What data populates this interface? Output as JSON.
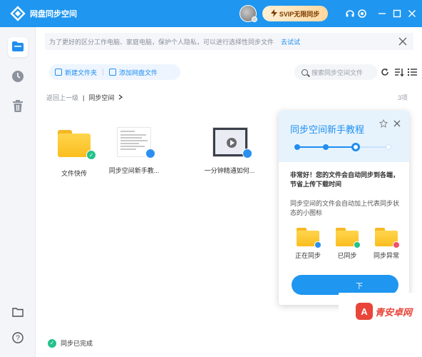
{
  "titlebar": {
    "app_title": "网盘同步空间",
    "svip_label": "SVIP无限同步",
    "icons": [
      "logo-icon",
      "avatar",
      "bolt-icon",
      "headset-icon",
      "settings-icon",
      "minimize-icon",
      "maximize-icon",
      "close-icon"
    ]
  },
  "sidebar": {
    "items": [
      {
        "icon": "folder-sync-icon",
        "active": true
      },
      {
        "icon": "clock-icon",
        "active": false
      },
      {
        "icon": "trash-icon",
        "active": false
      },
      {
        "icon": "folder-outline-icon",
        "active": false
      },
      {
        "icon": "help-icon",
        "active": false
      }
    ]
  },
  "notice": {
    "text": "为了更好的区分工作电脑、家庭电脑，保护个人隐私，可以进行选择性同步文件",
    "link": "去试试"
  },
  "toolbar": {
    "new_folder": "新建文件夹",
    "add_file": "添加网盘文件",
    "search_placeholder": "搜索同步空间文件"
  },
  "breadcrumb": {
    "back": "返回上一级",
    "current": "同步空间",
    "count": "3项"
  },
  "files": [
    {
      "name": "文件快传",
      "type": "folder",
      "badge": "synced"
    },
    {
      "name": "同步空间新手教...",
      "type": "doc",
      "badge": "cloud"
    },
    {
      "name": "一分钟精通如何...",
      "type": "video",
      "badge": "cloud"
    }
  ],
  "status": {
    "text": "同步已完成"
  },
  "tutorial": {
    "title": "同步空间新手教程",
    "steps_total": 4,
    "current_step": 3,
    "p1": "非常好！您的文件会自动同步到各端，节省上传下载时间",
    "p2": "同步空间的文件会自动加上代表同步状态的小图标",
    "icons": [
      {
        "label": "正在同步",
        "color": "#2b8ff0"
      },
      {
        "label": "已同步",
        "color": "#25c28a"
      },
      {
        "label": "同步异常",
        "color": "#f0506e"
      }
    ],
    "button": "下"
  },
  "watermark": {
    "text": "青安卓网"
  },
  "colors": {
    "accent": "#1f96ef",
    "synced": "#25c28a",
    "error": "#f0506e"
  }
}
